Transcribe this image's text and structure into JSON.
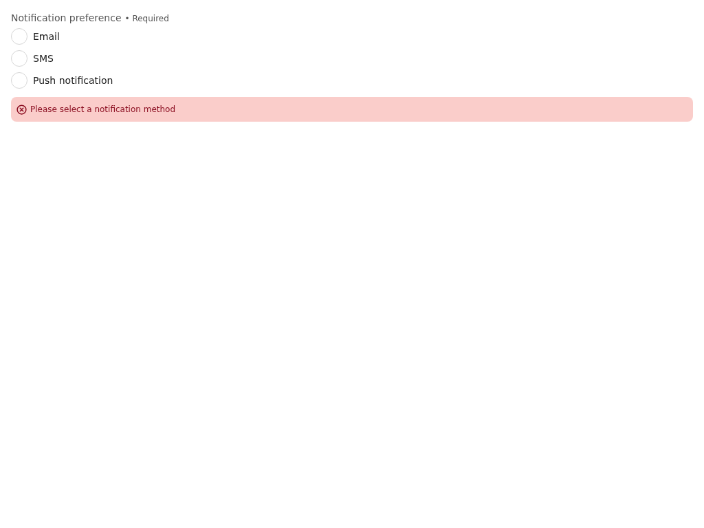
{
  "field": {
    "label": "Notification preference",
    "required_marker": "• Required"
  },
  "options": [
    {
      "label": "Email",
      "selected": false
    },
    {
      "label": "SMS",
      "selected": false
    },
    {
      "label": "Push notification",
      "selected": false
    }
  ],
  "error": {
    "message": "Please select a notification method"
  }
}
